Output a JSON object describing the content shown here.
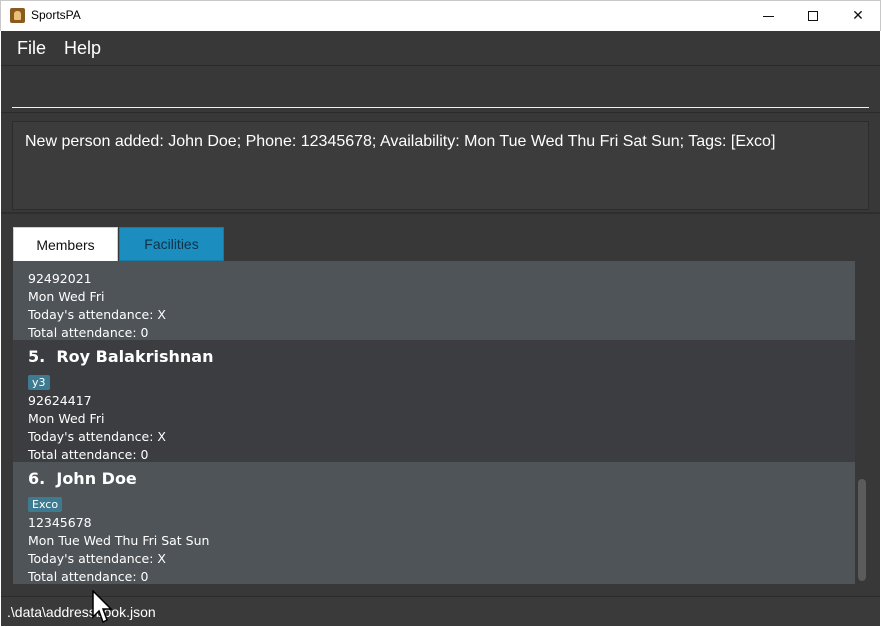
{
  "window": {
    "title": "SportsPA"
  },
  "menu": {
    "file": "File",
    "help": "Help"
  },
  "command": {
    "value": ""
  },
  "result": {
    "text": "New person added: John Doe; Phone: 12345678; Availability: Mon Tue Wed Thu Fri Sat Sun; Tags: [Exco]"
  },
  "tabs": {
    "members": "Members",
    "facilities": "Facilities"
  },
  "persons": [
    {
      "phone": "92492021",
      "availability": "Mon Wed Fri",
      "attendance_today": "Today's attendance: X",
      "attendance_total": "Total attendance: 0"
    },
    {
      "index": "5.",
      "name": "Roy Balakrishnan",
      "tag": "y3",
      "phone": "92624417",
      "availability": "Mon Wed Fri",
      "attendance_today": "Today's attendance: X",
      "attendance_total": "Total attendance: 0"
    },
    {
      "index": "6.",
      "name": "John Doe",
      "tag": "Exco",
      "phone": "12345678",
      "availability": "Mon Tue Wed Thu Fri Sat Sun",
      "attendance_today": "Today's attendance: X",
      "attendance_total": "Total attendance: 0"
    }
  ],
  "status": {
    "path": ".\\data\\addressbook.json"
  },
  "colors": {
    "background": "#383838",
    "card_light": "#4f5458",
    "card_dark": "#3b3d40",
    "tag": "#3e7b91",
    "tab_active_alt": "#1b8dbf"
  }
}
